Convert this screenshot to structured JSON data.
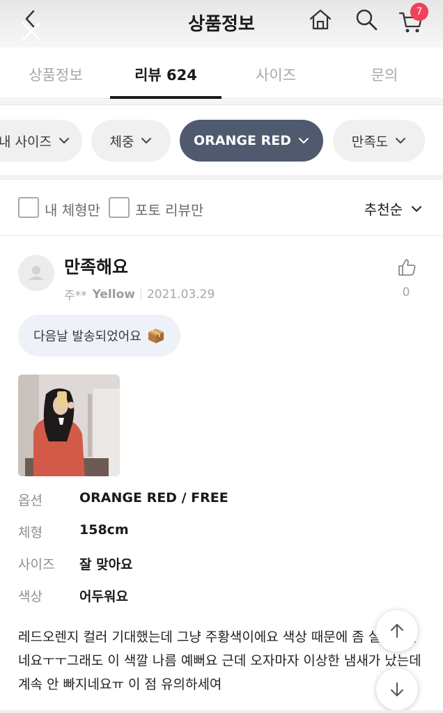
{
  "header": {
    "title": "상품정보",
    "cart_count": "7"
  },
  "tabs": [
    {
      "label": "상품정보",
      "active": false
    },
    {
      "label": "리뷰 624",
      "active": true
    },
    {
      "label": "사이즈",
      "active": false
    },
    {
      "label": "문의",
      "active": false
    }
  ],
  "filters": {
    "chips": [
      {
        "label": "내 사이즈",
        "active": false
      },
      {
        "label": "체중",
        "active": false
      },
      {
        "label": "ORANGE RED",
        "active": true
      },
      {
        "label": "만족도",
        "active": false
      }
    ],
    "my_body_label": "내 체형만",
    "photo_only_label": "포토 리뷰만",
    "sort_label": "추천순"
  },
  "review": {
    "title": "만족해요",
    "author": "주**",
    "color": "Yellow",
    "date": "2021.03.29",
    "likes": "0",
    "tag": "다음날 발송되었어요",
    "specs": [
      {
        "key": "옵션",
        "value": "ORANGE RED / FREE"
      },
      {
        "key": "체형",
        "value": "158cm"
      },
      {
        "key": "사이즈",
        "value": "잘 맞아요"
      },
      {
        "key": "색상",
        "value": "어두워요"
      }
    ],
    "body": "레드오렌지 컬러 기대했는데 그냥 주황색이에요 색상 때문에 좀 실망스럽네요ㅜㅜ그래도 이 색깔 나름 예뻐요 근데 오자마자 이상한 냄새가 났는데 계속 안 빠지네요ㅠ 이 점 유의하세여"
  },
  "colors": {
    "accent_chip": "#4f5a6e",
    "badge": "#f0425a",
    "tag_bg": "#eef1f8"
  },
  "icons": [
    "back-icon",
    "close-icon",
    "home-icon",
    "search-icon",
    "cart-icon",
    "chevron-down-icon",
    "thumbs-up-icon",
    "box-icon",
    "arrow-up-icon",
    "arrow-down-icon"
  ]
}
